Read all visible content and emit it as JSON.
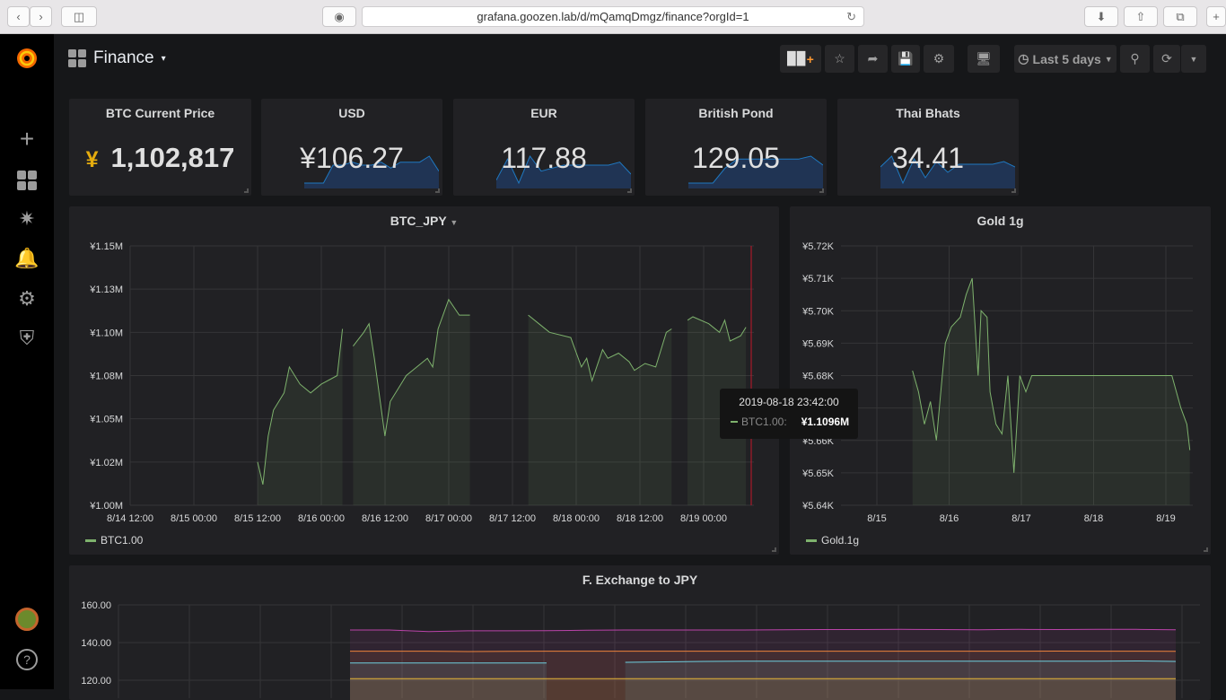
{
  "browser": {
    "url": "grafana.goozen.lab/d/mQamqDmgz/finance?orgId=1"
  },
  "sidebar": {
    "items": [
      "plus-icon",
      "dashboards-icon",
      "explore-icon",
      "alerting-icon",
      "configuration-icon",
      "server-admin-icon"
    ],
    "help": "?"
  },
  "header": {
    "title": "Finance",
    "time_range": "Last 5 days"
  },
  "stats": [
    {
      "title": "BTC Current Price",
      "prefix": "¥",
      "value": "1,102,817",
      "prefix_color": "#e5ac0e"
    },
    {
      "title": "USD",
      "value": "¥106.27",
      "spark": [
        105.9,
        105.9,
        105.9,
        106.5,
        106.5,
        106.6,
        106.5,
        106.5,
        106.6,
        106.4,
        106.6,
        106.6,
        106.6,
        106.8,
        106.3
      ]
    },
    {
      "title": "EUR",
      "value": "117.88",
      "spark": [
        117.6,
        118.3,
        117.5,
        118.4,
        117.9,
        118.0,
        118.1,
        118.1,
        118.1,
        118.1,
        118.1,
        118.2,
        117.8
      ]
    },
    {
      "title": "British Pond",
      "value": "129.05",
      "spark": [
        128.4,
        128.4,
        128.4,
        128.9,
        129.2,
        129.2,
        129.2,
        129.2,
        129.2,
        129.2,
        129.3,
        129.0
      ]
    },
    {
      "title": "Thai Bhats",
      "value": "34.41",
      "spark": [
        34.4,
        34.6,
        34.1,
        34.55,
        34.2,
        34.5,
        34.3,
        34.45,
        34.45,
        34.45,
        34.45,
        34.5,
        34.4
      ]
    }
  ],
  "chart_data": [
    {
      "type": "area",
      "title": "BTC_JPY",
      "yticks": [
        "¥1.00M",
        "¥1.02M",
        "¥1.05M",
        "¥1.08M",
        "¥1.10M",
        "¥1.13M",
        "¥1.15M"
      ],
      "ylim": [
        1.0,
        1.15
      ],
      "yunit": "M JPY",
      "xticks": [
        "8/14 12:00",
        "8/15 00:00",
        "8/15 12:00",
        "8/16 00:00",
        "8/16 12:00",
        "8/17 00:00",
        "8/17 12:00",
        "8/18 00:00",
        "8/18 12:00",
        "8/19 00:00"
      ],
      "xlim": [
        "2019-08-14T12:00",
        "2019-08-19T09:30"
      ],
      "grid": true,
      "legend": "bottom-left",
      "series": [
        {
          "name": "BTC1.00",
          "color": "#7eb26d",
          "points": [
            [
              "2019-08-15T12:00",
              1.025
            ],
            [
              "2019-08-15T13:00",
              1.012
            ],
            [
              "2019-08-15T14:00",
              1.04
            ],
            [
              "2019-08-15T15:00",
              1.055
            ],
            [
              "2019-08-15T17:00",
              1.065
            ],
            [
              "2019-08-15T18:00",
              1.08
            ],
            [
              "2019-08-15T20:00",
              1.07
            ],
            [
              "2019-08-15T22:00",
              1.065
            ],
            [
              "2019-08-16T00:00",
              1.07
            ],
            [
              "2019-08-16T03:00",
              1.075
            ],
            [
              "2019-08-16T04:00",
              1.102
            ],
            [
              "2019-08-16T05:00",
              null
            ],
            [
              "2019-08-16T06:00",
              1.092
            ],
            [
              "2019-08-16T08:00",
              1.1
            ],
            [
              "2019-08-16T09:00",
              1.105
            ],
            [
              "2019-08-16T10:00",
              1.085
            ],
            [
              "2019-08-16T12:00",
              1.04
            ],
            [
              "2019-08-16T13:00",
              1.06
            ],
            [
              "2019-08-16T15:00",
              1.07
            ],
            [
              "2019-08-16T16:00",
              1.075
            ],
            [
              "2019-08-16T18:00",
              1.08
            ],
            [
              "2019-08-16T20:00",
              1.085
            ],
            [
              "2019-08-16T21:00",
              1.08
            ],
            [
              "2019-08-16T22:00",
              1.102
            ],
            [
              "2019-08-17T00:00",
              1.119
            ],
            [
              "2019-08-17T02:00",
              1.11
            ],
            [
              "2019-08-17T04:00",
              1.11
            ],
            [
              "2019-08-17T12:00",
              null
            ],
            [
              "2019-08-17T15:00",
              1.11
            ],
            [
              "2019-08-17T17:00",
              1.105
            ],
            [
              "2019-08-17T19:00",
              1.1
            ],
            [
              "2019-08-17T23:00",
              1.097
            ],
            [
              "2019-08-18T01:00",
              1.08
            ],
            [
              "2019-08-18T02:00",
              1.085
            ],
            [
              "2019-08-18T03:00",
              1.072
            ],
            [
              "2019-08-18T05:00",
              1.09
            ],
            [
              "2019-08-18T06:00",
              1.085
            ],
            [
              "2019-08-18T08:00",
              1.088
            ],
            [
              "2019-08-18T10:00",
              1.083
            ],
            [
              "2019-08-18T11:00",
              1.078
            ],
            [
              "2019-08-18T13:00",
              1.082
            ],
            [
              "2019-08-18T15:00",
              1.08
            ],
            [
              "2019-08-18T17:00",
              1.1
            ],
            [
              "2019-08-18T18:00",
              1.102
            ],
            [
              "2019-08-18T20:00",
              null
            ],
            [
              "2019-08-18T21:00",
              1.107
            ],
            [
              "2019-08-18T22:00",
              1.109
            ],
            [
              "2019-08-19T01:00",
              1.105
            ],
            [
              "2019-08-19T03:00",
              1.1
            ],
            [
              "2019-08-19T04:00",
              1.107
            ],
            [
              "2019-08-19T05:00",
              1.095
            ],
            [
              "2019-08-19T07:00",
              1.098
            ],
            [
              "2019-08-19T08:00",
              1.103
            ]
          ]
        }
      ],
      "tooltip": {
        "time": "2019-08-18 23:42:00",
        "series": "BTC1.00:",
        "value": "¥1.1096M"
      }
    },
    {
      "type": "area",
      "title": "Gold 1g",
      "yticks": [
        "¥5.64K",
        "¥5.65K",
        "¥5.66K",
        "¥5.67K",
        "¥5.68K",
        "¥5.69K",
        "¥5.70K",
        "¥5.71K",
        "¥5.72K"
      ],
      "ylim": [
        5.64,
        5.72
      ],
      "yunit": "K JPY",
      "xticks": [
        "8/15",
        "8/16",
        "8/17",
        "8/18",
        "8/19"
      ],
      "xlim": [
        "2019-08-14T12:00",
        "2019-08-19T10:00"
      ],
      "grid": true,
      "legend": "bottom-left",
      "series": [
        {
          "name": "Gold.1g",
          "color": "#7eb26d",
          "points": [
            [
              "2019-08-15T12:00",
              5.6815
            ],
            [
              "2019-08-15T14:00",
              5.675
            ],
            [
              "2019-08-15T16:00",
              5.665
            ],
            [
              "2019-08-15T18:00",
              5.672
            ],
            [
              "2019-08-15T20:00",
              5.66
            ],
            [
              "2019-08-15T22:00",
              5.68
            ],
            [
              "2019-08-15T23:00",
              5.69
            ],
            [
              "2019-08-16T01:00",
              5.695
            ],
            [
              "2019-08-16T04:00",
              5.698
            ],
            [
              "2019-08-16T06:00",
              5.705
            ],
            [
              "2019-08-16T08:00",
              5.71
            ],
            [
              "2019-08-16T10:00",
              5.68
            ],
            [
              "2019-08-16T11:00",
              5.7
            ],
            [
              "2019-08-16T13:00",
              5.698
            ],
            [
              "2019-08-16T14:00",
              5.675
            ],
            [
              "2019-08-16T16:00",
              5.665
            ],
            [
              "2019-08-16T18:00",
              5.662
            ],
            [
              "2019-08-16T20:00",
              5.68
            ],
            [
              "2019-08-16T22:00",
              5.65
            ],
            [
              "2019-08-17T00:00",
              5.68
            ],
            [
              "2019-08-17T02:00",
              5.675
            ],
            [
              "2019-08-17T04:00",
              5.68
            ],
            [
              "2019-08-19T03:00",
              5.68
            ],
            [
              "2019-08-19T06:00",
              5.67
            ],
            [
              "2019-08-19T08:00",
              5.665
            ],
            [
              "2019-08-19T09:00",
              5.657
            ]
          ]
        }
      ]
    },
    {
      "type": "area",
      "title": "F. Exchange to JPY",
      "yticks": [
        "120.00",
        "140.00",
        "160.00"
      ],
      "ylim": [
        117,
        165
      ],
      "grid": true,
      "series": [
        {
          "color": "#ba43a9",
          "values": [
            149,
            149,
            148,
            148.5,
            148.5,
            148.6,
            148.8,
            149,
            149,
            149,
            149,
            149.2,
            149.3,
            149.3,
            149.4,
            149.3,
            149.2,
            149.4,
            149.3,
            149.4,
            149.4,
            149.2
          ]
        },
        {
          "color": "#ef843c",
          "values": [
            135.5,
            135.5,
            135.5,
            135.3,
            135.4,
            135.5,
            135.5,
            135.5,
            135.5,
            135.5,
            135.5,
            135.5,
            135.5,
            135.5,
            135.5,
            135.5,
            135.5,
            135.5,
            135.6,
            135.5,
            135.5,
            135.4
          ]
        },
        {
          "color": "#6ed0e0",
          "values": [
            128,
            128,
            128,
            128,
            128,
            128,
            null,
            128.4,
            128.7,
            129,
            129.1,
            129.2,
            129.2,
            129.2,
            129.2,
            129.2,
            129.2,
            129.2,
            129.2,
            129.2,
            129.3,
            129
          ]
        },
        {
          "color": "#eab839",
          "values": [
            118,
            118,
            118,
            118,
            118,
            118,
            118,
            118,
            118,
            118,
            118,
            118,
            118,
            118,
            118,
            118,
            118,
            118,
            118,
            118,
            118,
            118
          ]
        }
      ]
    }
  ]
}
